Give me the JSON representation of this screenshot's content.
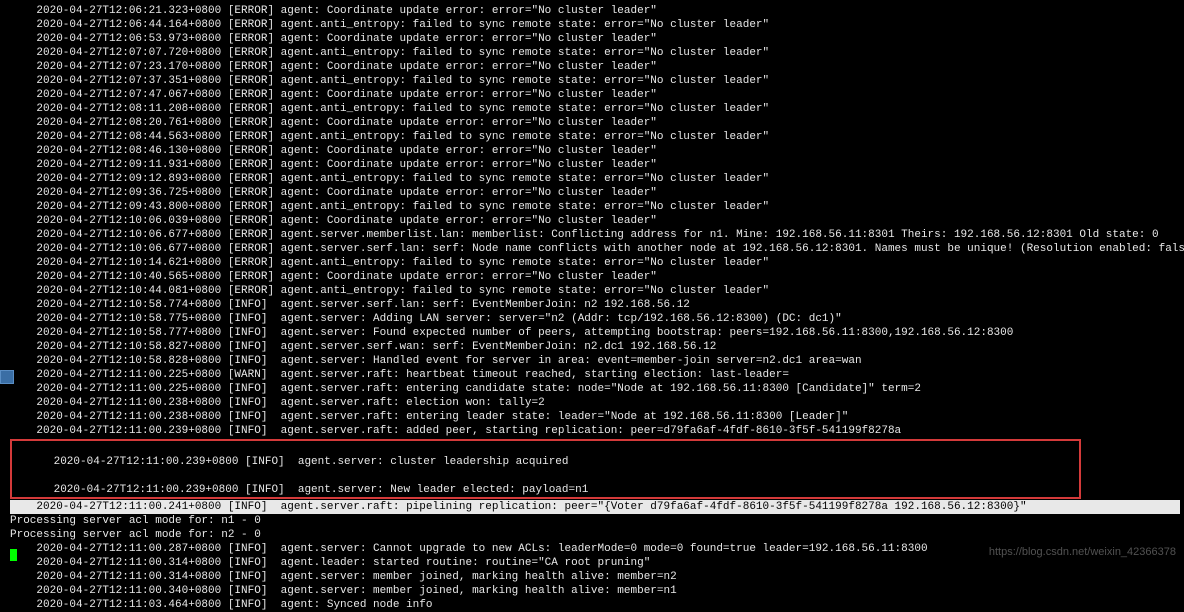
{
  "log_lines": [
    {
      "ts": "2020-04-27T12:06:21.323+0800",
      "lvl": "[ERROR]",
      "msg": "agent: Coordinate update error: error=\"No cluster leader\""
    },
    {
      "ts": "2020-04-27T12:06:44.164+0800",
      "lvl": "[ERROR]",
      "msg": "agent.anti_entropy: failed to sync remote state: error=\"No cluster leader\""
    },
    {
      "ts": "2020-04-27T12:06:53.973+0800",
      "lvl": "[ERROR]",
      "msg": "agent: Coordinate update error: error=\"No cluster leader\""
    },
    {
      "ts": "2020-04-27T12:07:07.720+0800",
      "lvl": "[ERROR]",
      "msg": "agent.anti_entropy: failed to sync remote state: error=\"No cluster leader\""
    },
    {
      "ts": "2020-04-27T12:07:23.170+0800",
      "lvl": "[ERROR]",
      "msg": "agent: Coordinate update error: error=\"No cluster leader\""
    },
    {
      "ts": "2020-04-27T12:07:37.351+0800",
      "lvl": "[ERROR]",
      "msg": "agent.anti_entropy: failed to sync remote state: error=\"No cluster leader\""
    },
    {
      "ts": "2020-04-27T12:07:47.067+0800",
      "lvl": "[ERROR]",
      "msg": "agent: Coordinate update error: error=\"No cluster leader\""
    },
    {
      "ts": "2020-04-27T12:08:11.208+0800",
      "lvl": "[ERROR]",
      "msg": "agent.anti_entropy: failed to sync remote state: error=\"No cluster leader\""
    },
    {
      "ts": "2020-04-27T12:08:20.761+0800",
      "lvl": "[ERROR]",
      "msg": "agent: Coordinate update error: error=\"No cluster leader\""
    },
    {
      "ts": "2020-04-27T12:08:44.563+0800",
      "lvl": "[ERROR]",
      "msg": "agent.anti_entropy: failed to sync remote state: error=\"No cluster leader\""
    },
    {
      "ts": "2020-04-27T12:08:46.130+0800",
      "lvl": "[ERROR]",
      "msg": "agent: Coordinate update error: error=\"No cluster leader\""
    },
    {
      "ts": "2020-04-27T12:09:11.931+0800",
      "lvl": "[ERROR]",
      "msg": "agent: Coordinate update error: error=\"No cluster leader\""
    },
    {
      "ts": "2020-04-27T12:09:12.893+0800",
      "lvl": "[ERROR]",
      "msg": "agent.anti_entropy: failed to sync remote state: error=\"No cluster leader\""
    },
    {
      "ts": "2020-04-27T12:09:36.725+0800",
      "lvl": "[ERROR]",
      "msg": "agent: Coordinate update error: error=\"No cluster leader\""
    },
    {
      "ts": "2020-04-27T12:09:43.800+0800",
      "lvl": "[ERROR]",
      "msg": "agent.anti_entropy: failed to sync remote state: error=\"No cluster leader\""
    },
    {
      "ts": "2020-04-27T12:10:06.039+0800",
      "lvl": "[ERROR]",
      "msg": "agent: Coordinate update error: error=\"No cluster leader\""
    },
    {
      "ts": "2020-04-27T12:10:06.677+0800",
      "lvl": "[ERROR]",
      "msg": "agent.server.memberlist.lan: memberlist: Conflicting address for n1. Mine: 192.168.56.11:8301 Theirs: 192.168.56.12:8301 Old state: 0"
    },
    {
      "ts": "2020-04-27T12:10:06.677+0800",
      "lvl": "[ERROR]",
      "msg": "agent.server.serf.lan: serf: Node name conflicts with another node at 192.168.56.12:8301. Names must be unique! (Resolution enabled: false)"
    },
    {
      "ts": "2020-04-27T12:10:14.621+0800",
      "lvl": "[ERROR]",
      "msg": "agent.anti_entropy: failed to sync remote state: error=\"No cluster leader\""
    },
    {
      "ts": "2020-04-27T12:10:40.565+0800",
      "lvl": "[ERROR]",
      "msg": "agent: Coordinate update error: error=\"No cluster leader\""
    },
    {
      "ts": "2020-04-27T12:10:44.081+0800",
      "lvl": "[ERROR]",
      "msg": "agent.anti_entropy: failed to sync remote state: error=\"No cluster leader\""
    },
    {
      "ts": "2020-04-27T12:10:58.774+0800",
      "lvl": "[INFO]",
      "msg": " agent.server.serf.lan: serf: EventMemberJoin: n2 192.168.56.12"
    },
    {
      "ts": "2020-04-27T12:10:58.775+0800",
      "lvl": "[INFO]",
      "msg": " agent.server: Adding LAN server: server=\"n2 (Addr: tcp/192.168.56.12:8300) (DC: dc1)\""
    },
    {
      "ts": "2020-04-27T12:10:58.777+0800",
      "lvl": "[INFO]",
      "msg": " agent.server: Found expected number of peers, attempting bootstrap: peers=192.168.56.11:8300,192.168.56.12:8300"
    },
    {
      "ts": "2020-04-27T12:10:58.827+0800",
      "lvl": "[INFO]",
      "msg": " agent.server.serf.wan: serf: EventMemberJoin: n2.dc1 192.168.56.12"
    },
    {
      "ts": "2020-04-27T12:10:58.828+0800",
      "lvl": "[INFO]",
      "msg": " agent.server: Handled event for server in area: event=member-join server=n2.dc1 area=wan"
    },
    {
      "ts": "2020-04-27T12:11:00.225+0800",
      "lvl": "[WARN]",
      "msg": " agent.server.raft: heartbeat timeout reached, starting election: last-leader="
    },
    {
      "ts": "2020-04-27T12:11:00.225+0800",
      "lvl": "[INFO]",
      "msg": " agent.server.raft: entering candidate state: node=\"Node at 192.168.56.11:8300 [Candidate]\" term=2"
    },
    {
      "ts": "2020-04-27T12:11:00.238+0800",
      "lvl": "[INFO]",
      "msg": " agent.server.raft: election won: tally=2"
    },
    {
      "ts": "2020-04-27T12:11:00.238+0800",
      "lvl": "[INFO]",
      "msg": " agent.server.raft: entering leader state: leader=\"Node at 192.168.56.11:8300 [Leader]\""
    },
    {
      "ts": "2020-04-27T12:11:00.239+0800",
      "lvl": "[INFO]",
      "msg": " agent.server.raft: added peer, starting replication: peer=d79fa6af-4fdf-8610-3f5f-541199f8278a"
    }
  ],
  "highlight_pre": {
    "ts": "2020-04-27T12:11:00.239+0800",
    "lvl": "[INFO]",
    "msg": " agent.server: cluster leadership acquired"
  },
  "highlight_line": {
    "ts": "2020-04-27T12:11:00.239+0800",
    "lvl": "[INFO]",
    "msg": " agent.server: New leader elected: payload=n1"
  },
  "selected_line": {
    "ts": "2020-04-27T12:11:00.241+0800",
    "lvl": "[INFO]",
    "msg": " agent.server.raft: pipelining replication: peer=\"{Voter d79fa6af-4fdf-8610-3f5f-541199f8278a 192.168.56.12:8300}\""
  },
  "processing_lines": [
    "Processing server acl mode for: n1 - 0",
    "Processing server acl mode for: n2 - 0"
  ],
  "tail_lines": [
    {
      "ts": "2020-04-27T12:11:00.287+0800",
      "lvl": "[INFO]",
      "msg": " agent.server: Cannot upgrade to new ACLs: leaderMode=0 mode=0 found=true leader=192.168.56.11:8300"
    },
    {
      "ts": "2020-04-27T12:11:00.314+0800",
      "lvl": "[INFO]",
      "msg": " agent.leader: started routine: routine=\"CA root pruning\""
    },
    {
      "ts": "2020-04-27T12:11:00.314+0800",
      "lvl": "[INFO]",
      "msg": " agent.server: member joined, marking health alive: member=n2"
    },
    {
      "ts": "2020-04-27T12:11:00.340+0800",
      "lvl": "[INFO]",
      "msg": " agent.server: member joined, marking health alive: member=n1"
    },
    {
      "ts": "2020-04-27T12:11:03.464+0800",
      "lvl": "[INFO]",
      "msg": " agent: Synced node info"
    }
  ],
  "watermark": "https://blog.csdn.net/weixin_42366378"
}
